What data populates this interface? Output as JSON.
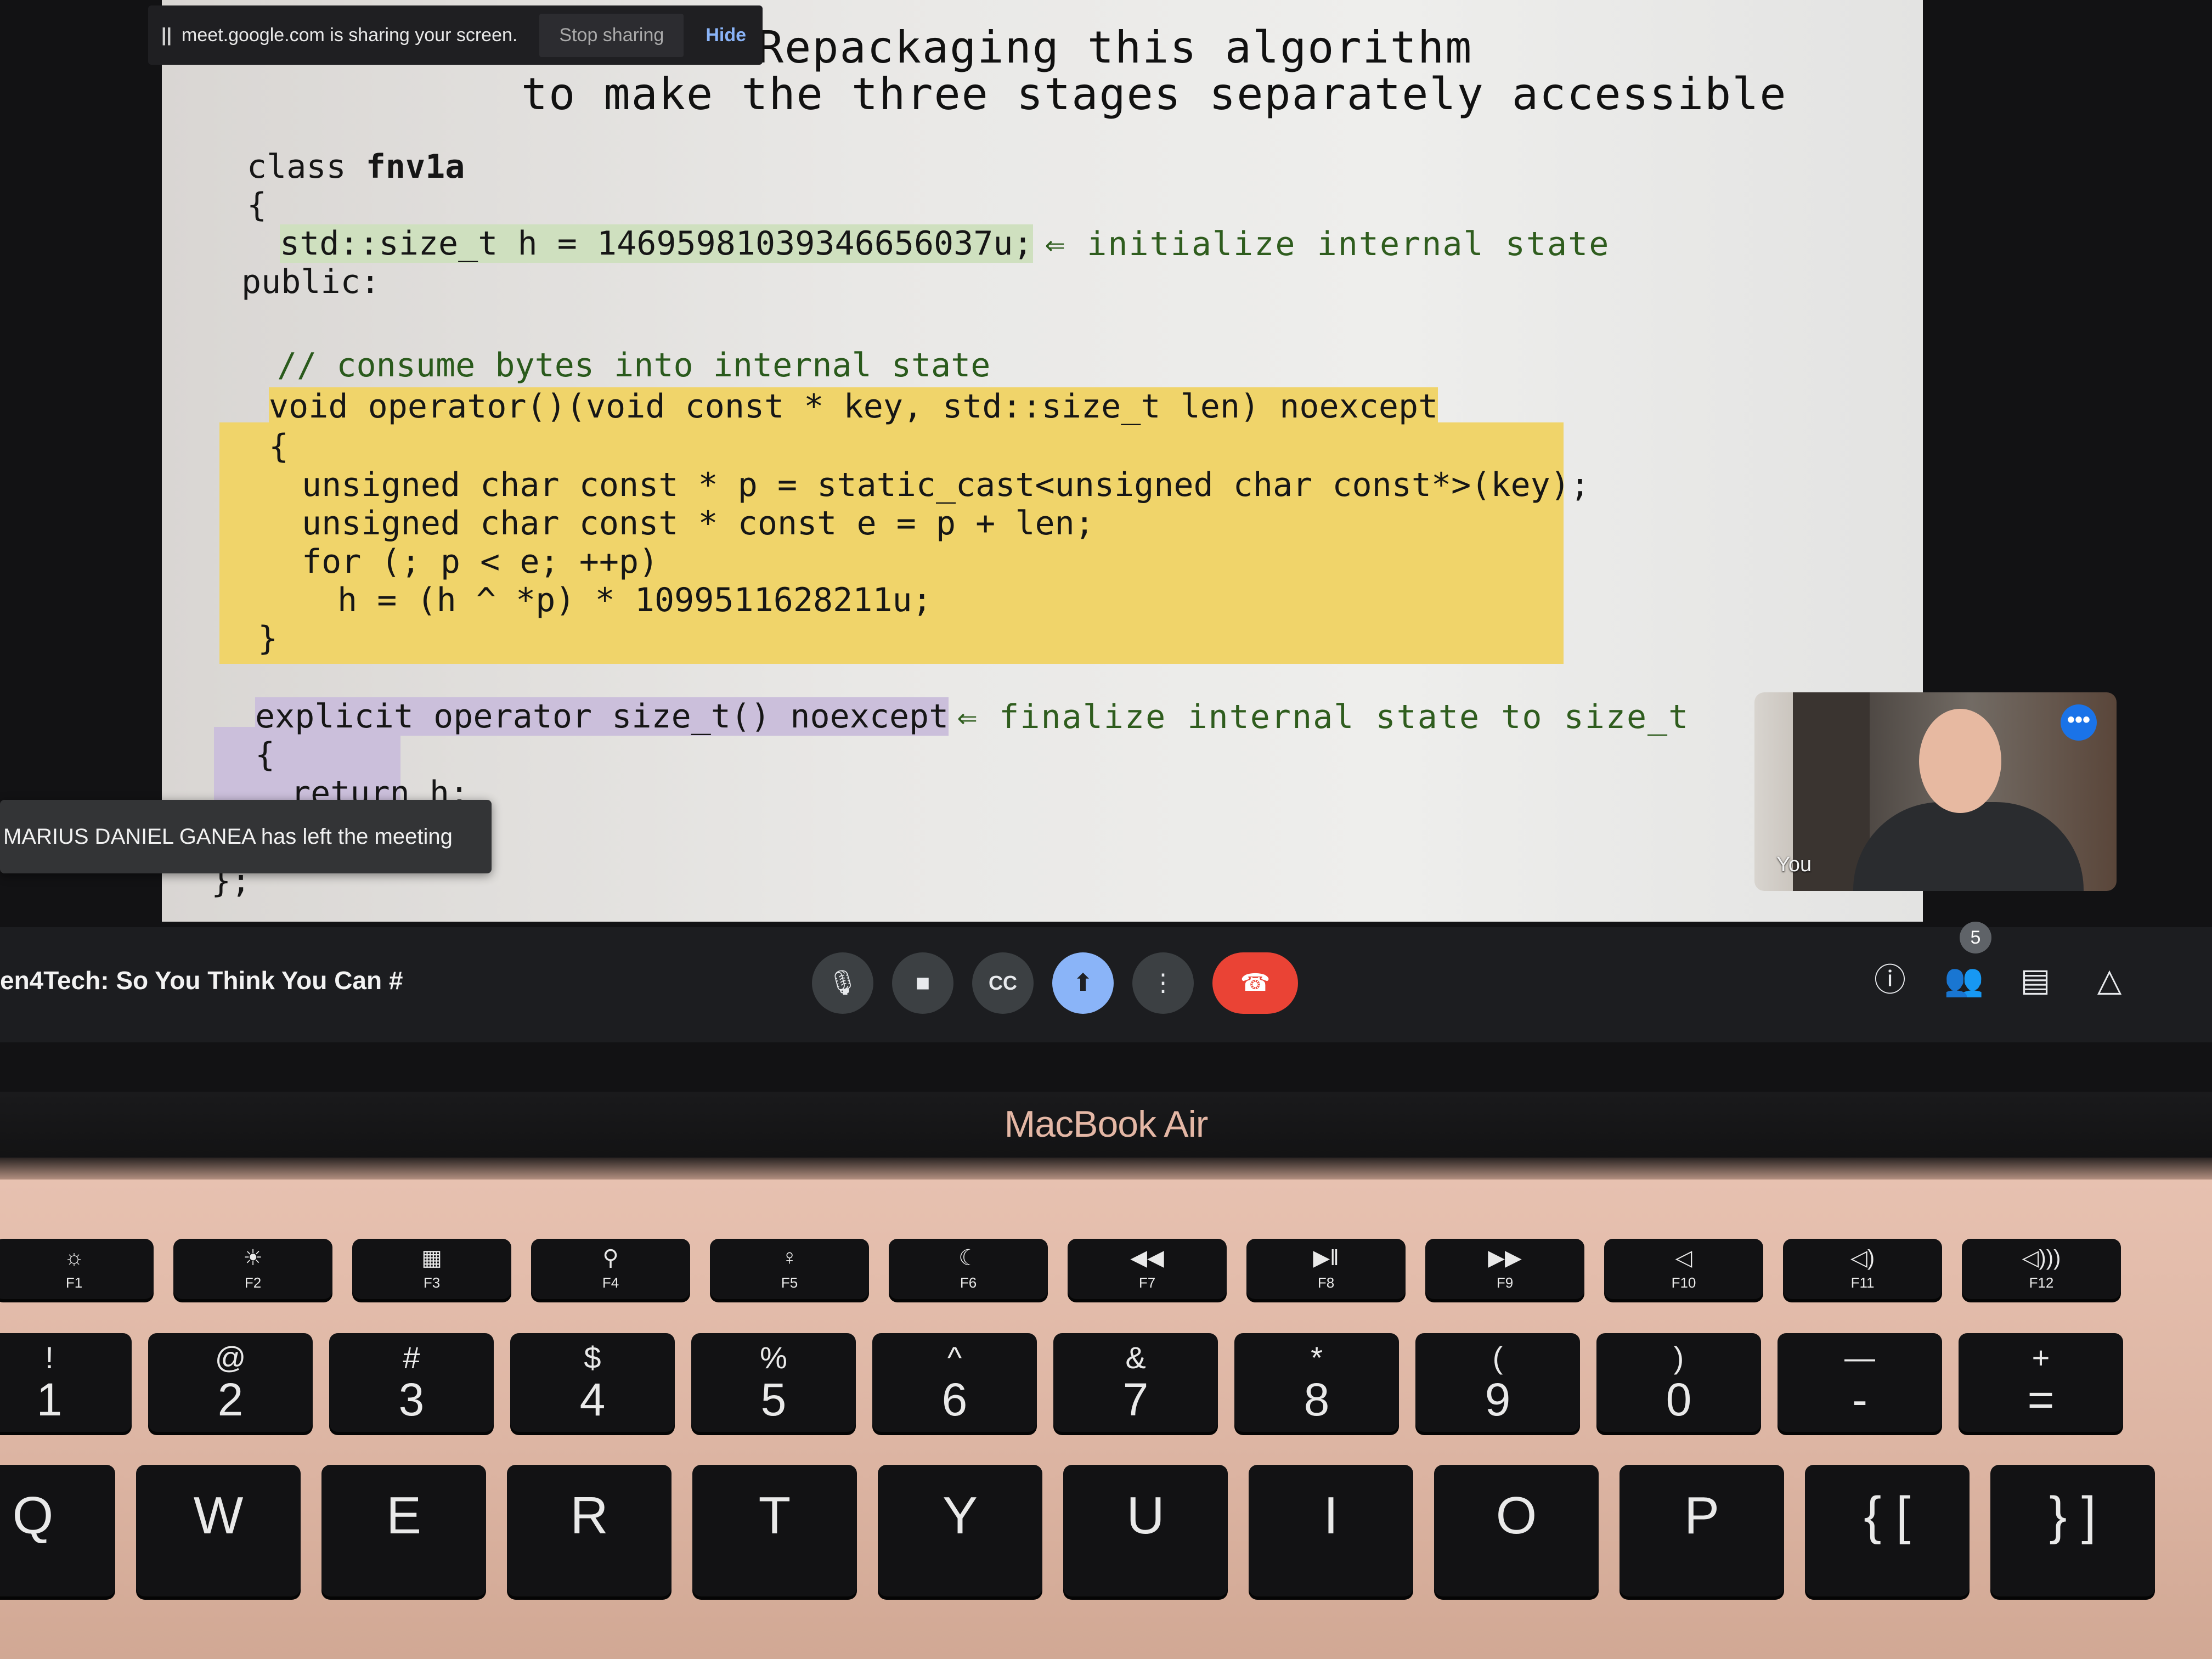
{
  "share_banner": {
    "message": "meet.google.com is sharing your screen.",
    "stop_label": "Stop sharing",
    "hide_label": "Hide"
  },
  "slide": {
    "title_line1": "Repackaging this algorithm",
    "title_line2": "to make the three stages separately accessible",
    "code": {
      "l1_kw": "class ",
      "l1_name": "fnv1a",
      "l2": "{",
      "l3": "std::size_t h = 14695981039346656037u;",
      "l4": "public:",
      "l5": "// consume bytes into internal state",
      "l6": "void operator()(void const * key, std::size_t len) noexcept",
      "l7": "{",
      "l8": "unsigned char const * p = static_cast<unsigned char const*>(key);",
      "l9": "unsigned char const * const e = p + len;",
      "l10": "for (; p < e; ++p)",
      "l11": "h = (h ^ *p) * 1099511628211u;",
      "l12": "}",
      "l13": "explicit operator size_t() noexcept",
      "l14": "{",
      "l15": "return h;",
      "l16": "};"
    },
    "note_initialize": "⇐ initialize internal state",
    "note_finalize": "⇐ finalize internal state to size_t"
  },
  "toast": {
    "text": "MARIUS DANIEL GANEA has left the meeting"
  },
  "self_view": {
    "label": "You",
    "more_icon": "•••"
  },
  "meet_bar": {
    "meeting_title": "en4Tech: So You Think You Can #",
    "participants_count": "5",
    "icons": {
      "mic": "🎙",
      "camera": "■",
      "captions": "CC",
      "present": "⬆",
      "more": "⋮",
      "leave": "☎",
      "info": "ⓘ",
      "people": "👥",
      "chat": "▤",
      "activities": "△"
    }
  },
  "bezel": {
    "label": "MacBook Air"
  },
  "keyboard": {
    "fkeys": [
      {
        "icon": "☼",
        "label": "F1"
      },
      {
        "icon": "☀",
        "label": "F2"
      },
      {
        "icon": "▦",
        "label": "F3"
      },
      {
        "icon": "⚲",
        "label": "F4"
      },
      {
        "icon": "♀",
        "label": "F5"
      },
      {
        "icon": "☾",
        "label": "F6"
      },
      {
        "icon": "◀◀",
        "label": "F7"
      },
      {
        "icon": "▶‖",
        "label": "F8"
      },
      {
        "icon": "▶▶",
        "label": "F9"
      },
      {
        "icon": "◁",
        "label": "F10"
      },
      {
        "icon": "◁)",
        "label": "F11"
      },
      {
        "icon": "◁)))",
        "label": "F12"
      }
    ],
    "numkeys": [
      {
        "top": "!",
        "main": "1"
      },
      {
        "top": "@",
        "main": "2"
      },
      {
        "top": "#",
        "main": "3"
      },
      {
        "top": "$",
        "main": "4"
      },
      {
        "top": "%",
        "main": "5"
      },
      {
        "top": "^",
        "main": "6"
      },
      {
        "top": "&",
        "main": "7"
      },
      {
        "top": "*",
        "main": "8"
      },
      {
        "top": "(",
        "main": "9"
      },
      {
        "top": ")",
        "main": "0"
      },
      {
        "top": "—",
        "main": "-"
      },
      {
        "top": "+",
        "main": "="
      }
    ],
    "letterkeys": [
      {
        "main": "Q"
      },
      {
        "main": "W"
      },
      {
        "main": "E"
      },
      {
        "main": "R"
      },
      {
        "main": "T"
      },
      {
        "main": "Y"
      },
      {
        "main": "U"
      },
      {
        "main": "I"
      },
      {
        "main": "O"
      },
      {
        "main": "P"
      },
      {
        "main": "{ ["
      },
      {
        "main": "} ]"
      }
    ]
  }
}
